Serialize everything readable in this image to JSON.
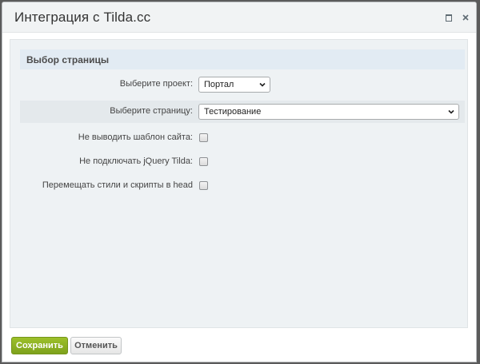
{
  "window": {
    "title": "Интеграция с Tilda.cc"
  },
  "section": {
    "title": "Выбор страницы"
  },
  "form": {
    "project_label": "Выберите проект:",
    "project_value": "Портал",
    "page_label": "Выберите страницу:",
    "page_value": "Тестирование",
    "no_template_label": "Не выводить шаблон сайта:",
    "no_jquery_label": "Не подключать jQuery Tilda:",
    "move_styles_label": "Перемещать стили и скрипты в head"
  },
  "checkboxes": {
    "no_template_checked": false,
    "no_jquery_checked": false,
    "move_styles_checked": false
  },
  "buttons": {
    "save_label": "Сохранить",
    "cancel_label": "Отменить"
  },
  "colors": {
    "save_button": "#8cb024",
    "section_header": "#e2ebf3",
    "content_bg": "#eef2f4"
  }
}
